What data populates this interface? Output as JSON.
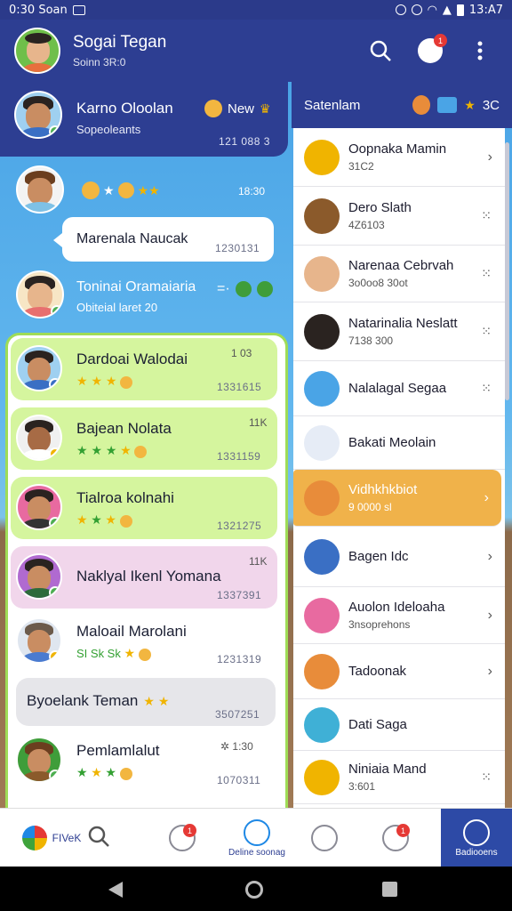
{
  "status_bar": {
    "time": "0:30 Soan",
    "right": "13:A7"
  },
  "header": {
    "title": "Sogai Tegan",
    "subtitle": "Soinn 3R:0",
    "notif_badge": "1"
  },
  "left_chats": [
    {
      "name": "Karno Oloolan",
      "sub": "Sopeoleants",
      "tag": "New",
      "num": "121 088 3"
    },
    {
      "name": "",
      "sub": "",
      "meta": "18:30",
      "bubble": "Marenala Naucak",
      "num": "1230131"
    },
    {
      "name": "Toninai Oramaiaria",
      "sub": "Obiteial laret 20"
    },
    {
      "name": "Dardoai Walodai",
      "meta": "1 03",
      "num": "1331615"
    },
    {
      "name": "Bajean Nolata",
      "meta": "11K",
      "num": "1331159"
    },
    {
      "name": "Tialroa kolnahi",
      "num": "1321275"
    },
    {
      "name": "Naklyal Ikenl Yomana",
      "meta": "11K",
      "num": "1337391"
    },
    {
      "name": "Maloail Marolani",
      "sub": "SI Sk Sk",
      "num": "1231319"
    },
    {
      "name": "Byoelank Teman",
      "num": "3507251"
    },
    {
      "name": "Pemlamlalut",
      "meta": "1:30",
      "num": "1070311"
    }
  ],
  "right_panel": {
    "title": "Satenlam",
    "count": "3C",
    "items": [
      {
        "name": "Oopnaka Mamin",
        "sub": "31C2",
        "action": "chevron"
      },
      {
        "name": "Dero Slath",
        "sub": "4Z6103",
        "action": "dots"
      },
      {
        "name": "Narenaa Cebrvah",
        "sub": "3o0oo8 30ot",
        "action": "dots"
      },
      {
        "name": "Natarinalia Neslatt",
        "sub": "7138 300",
        "action": "dots"
      },
      {
        "name": "Nalalagal Segaa",
        "sub": "",
        "action": "dots"
      },
      {
        "name": "Bakati Meolain",
        "sub": "",
        "action": "none"
      },
      {
        "name": "Vidhkhkbiot",
        "sub": "9 0000 sl",
        "action": "chevron",
        "highlight": true
      },
      {
        "name": "Bagen Idc",
        "sub": "",
        "action": "chevron"
      },
      {
        "name": "Auolon Ideloaha",
        "sub": "3nsoprehons",
        "action": "chevron"
      },
      {
        "name": "Tadoonak",
        "sub": "",
        "action": "chevron"
      },
      {
        "name": "Dati Saga",
        "sub": "",
        "action": "none"
      },
      {
        "name": "Niniaia Mand",
        "sub": "3:601",
        "action": "dots"
      }
    ]
  },
  "bottom_nav": {
    "items": [
      {
        "label": "FIVeK"
      },
      {
        "label": ""
      },
      {
        "label": "Deline soonag"
      },
      {
        "label": ""
      },
      {
        "label": ""
      },
      {
        "label": "Badiooens"
      }
    ],
    "badge": "1"
  }
}
